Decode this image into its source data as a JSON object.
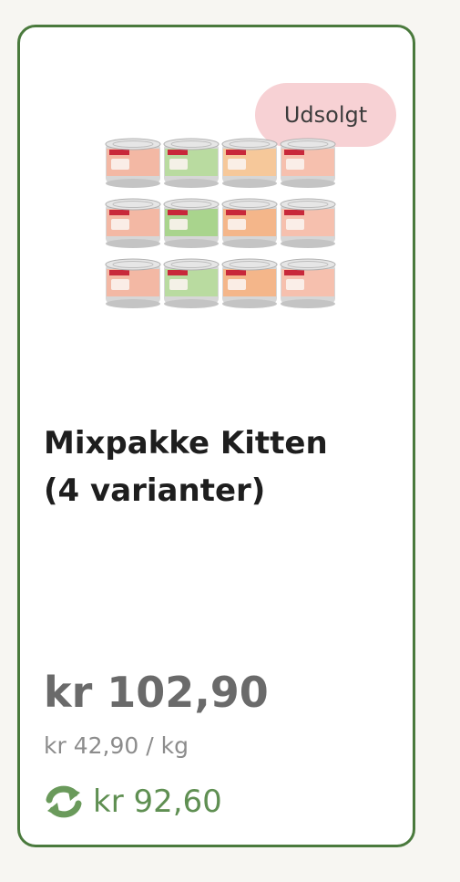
{
  "product": {
    "badge": "Udsolgt",
    "image_icon": "cat-food-cans-mixpack",
    "title_line1": "Mixpakke Kitten",
    "title_line2": "(4 varianter)",
    "price": "kr 102,90",
    "unit_price": "kr 42,90 / kg",
    "subscription_icon": "refresh-icon",
    "subscription_price": "kr 92,60"
  },
  "colors": {
    "card_border": "#4a7a3d",
    "badge_bg": "#f7d1d4",
    "subscription_green": "#5f8f52"
  }
}
